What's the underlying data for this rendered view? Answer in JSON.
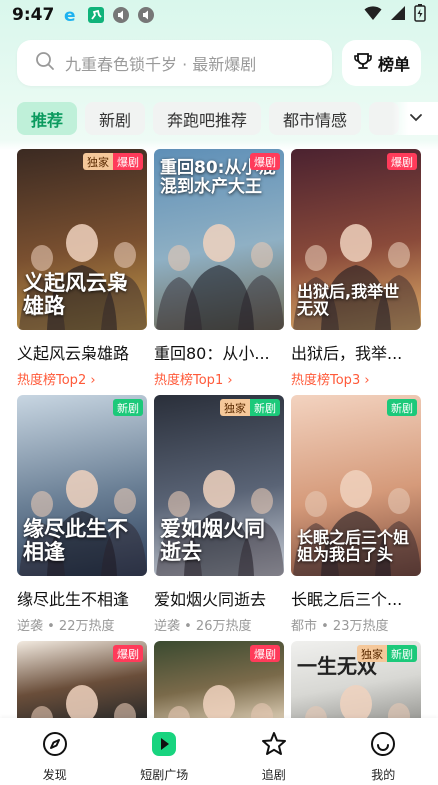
{
  "status": {
    "time": "9:47"
  },
  "search": {
    "placeholder": "九重春色锁千岁 · 最新爆剧"
  },
  "rank_button": {
    "label": "榜单"
  },
  "tabs": [
    {
      "label": "推荐",
      "active": true
    },
    {
      "label": "新剧",
      "active": false
    },
    {
      "label": "奔跑吧推荐",
      "active": false
    },
    {
      "label": "都市情感",
      "active": false
    }
  ],
  "cards": [
    {
      "title": "义起风云枭雄路",
      "sub": "热度榜Top2 ›",
      "sub_type": "rank",
      "badges": [
        "独家",
        "爆剧"
      ],
      "poster_text": "义起风云枭雄路",
      "colors": [
        "#3b2a22",
        "#7a5030",
        "#c29a4a"
      ]
    },
    {
      "title": "重回80：从小...",
      "sub": "热度榜Top1 ›",
      "sub_type": "rank",
      "badges": [
        "爆剧"
      ],
      "poster_text": "重回80:从小混混到水产大王",
      "colors": [
        "#5e8fb7",
        "#8fb0c4",
        "#6f6a55"
      ]
    },
    {
      "title": "出狱后，我举...",
      "sub": "热度榜Top3 ›",
      "sub_type": "rank",
      "badges": [
        "爆剧"
      ],
      "poster_text": "出狱后,我举世无双",
      "colors": [
        "#4b2230",
        "#8a4a3a",
        "#e0b06a"
      ]
    },
    {
      "title": "缘尽此生不相逢",
      "sub": "逆袭 • 22万热度",
      "sub_type": "meta",
      "badges": [
        "新剧"
      ],
      "poster_text": "缘尽此生不相逢",
      "colors": [
        "#c8d6e2",
        "#6a7f95",
        "#2d3f5a"
      ]
    },
    {
      "title": "爱如烟火同逝去",
      "sub": "逆袭 • 26万热度",
      "sub_type": "meta",
      "badges": [
        "独家",
        "新剧"
      ],
      "poster_text": "爱如烟火同逝去",
      "colors": [
        "#2a2f3a",
        "#5a6476",
        "#c9cfd8"
      ]
    },
    {
      "title": "长眠之后三个...",
      "sub": "都市 • 23万热度",
      "sub_type": "meta",
      "badges": [
        "新剧"
      ],
      "poster_text": "长眠之后三个姐姐为我白了头",
      "colors": [
        "#f3d3c0",
        "#d59a7a",
        "#7a4a3a"
      ]
    },
    {
      "title": "",
      "sub": "",
      "sub_type": "meta",
      "badges": [
        "爆剧"
      ],
      "poster_text": "",
      "colors": [
        "#f2eae0",
        "#6a4e3a",
        "#2a2a2a"
      ]
    },
    {
      "title": "",
      "sub": "",
      "sub_type": "meta",
      "badges": [
        "爆剧"
      ],
      "poster_text": "",
      "colors": [
        "#3a4a30",
        "#7a6a4a",
        "#d8c9b0"
      ]
    },
    {
      "title": "",
      "sub": "",
      "sub_type": "meta",
      "badges": [
        "独家",
        "新剧"
      ],
      "poster_text": "一生无双",
      "colors": [
        "#f0f0ee",
        "#d8d8d4",
        "#9a9a96"
      ]
    }
  ],
  "nav": [
    {
      "label": "发现",
      "icon": "compass-icon"
    },
    {
      "label": "短剧广场",
      "icon": "play-icon"
    },
    {
      "label": "追剧",
      "icon": "star-icon"
    },
    {
      "label": "我的",
      "icon": "smile-icon"
    }
  ]
}
